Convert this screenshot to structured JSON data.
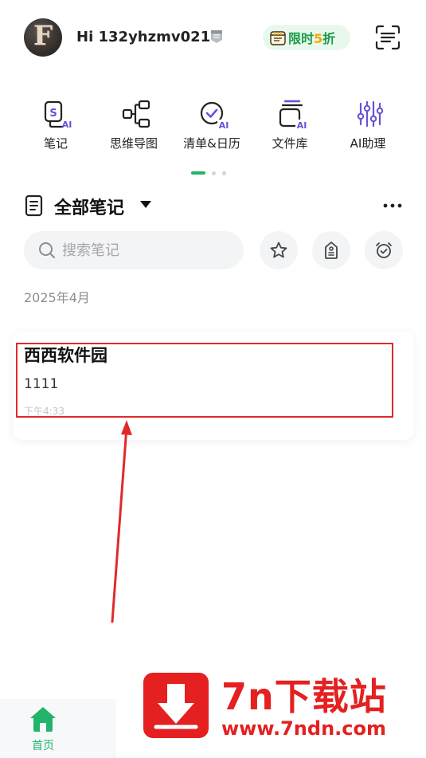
{
  "header": {
    "avatar_letter": "F",
    "greeting": "Hi 132yhzmv021",
    "promo": {
      "prefix": "限时",
      "number": "5",
      "suffix": "折"
    }
  },
  "quick_actions": [
    {
      "label": "笔记",
      "icon": "note-ai-icon"
    },
    {
      "label": "思维导图",
      "icon": "mindmap-icon"
    },
    {
      "label": "清单&日历",
      "icon": "checklist-ai-icon"
    },
    {
      "label": "文件库",
      "icon": "file-library-ai-icon"
    },
    {
      "label": "AI助理",
      "icon": "ai-assistant-icon"
    }
  ],
  "pager": {
    "pages": 3,
    "active": 0
  },
  "notes_section": {
    "title": "全部笔记",
    "search_placeholder": "搜索笔记",
    "month": "2025年4月"
  },
  "notes": [
    {
      "title": "西西软件园",
      "body": "1111",
      "time": "下午4:33"
    }
  ],
  "bottom_nav": {
    "home_label": "首页"
  },
  "watermark": {
    "title": "7n下载站",
    "url": "www.7ndn.com"
  },
  "colors": {
    "accent": "#22b46a",
    "promo_bg": "#e9f8ec",
    "promo_number": "#f7a600",
    "annotation": "#e02a2a",
    "watermark": "#e42020"
  }
}
